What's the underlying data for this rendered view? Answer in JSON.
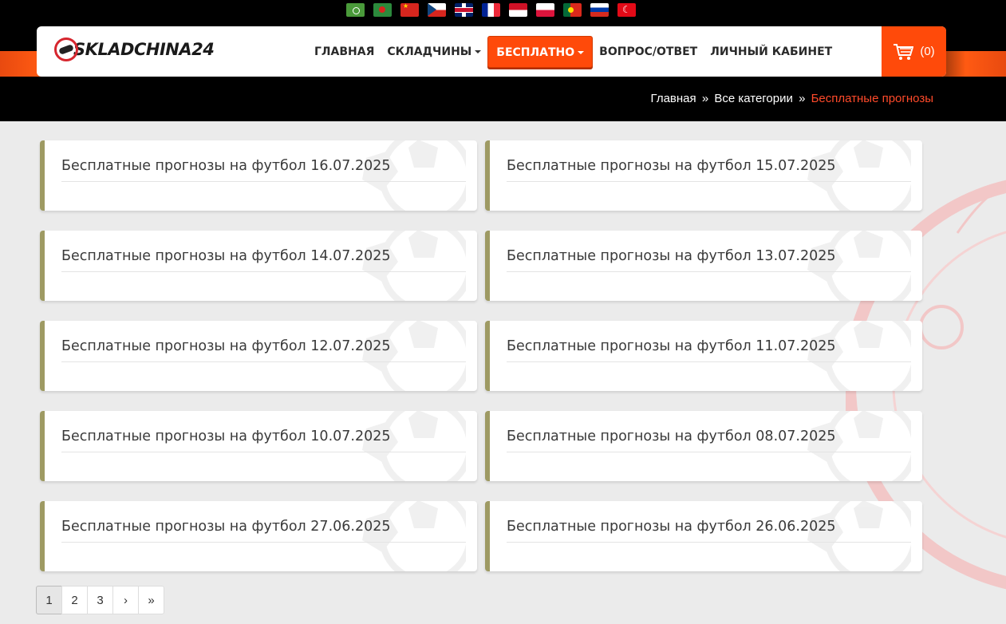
{
  "languages": [
    {
      "code": "ar",
      "icon": "flag-arabic-icon"
    },
    {
      "code": "bn",
      "icon": "flag-bangladesh-icon"
    },
    {
      "code": "zh",
      "icon": "flag-china-icon"
    },
    {
      "code": "cs",
      "icon": "flag-czech-icon"
    },
    {
      "code": "en",
      "icon": "flag-uk-icon"
    },
    {
      "code": "fr",
      "icon": "flag-france-icon"
    },
    {
      "code": "id",
      "icon": "flag-indonesia-icon"
    },
    {
      "code": "pl",
      "icon": "flag-poland-icon"
    },
    {
      "code": "pt",
      "icon": "flag-portugal-icon"
    },
    {
      "code": "ru",
      "icon": "flag-russia-icon"
    },
    {
      "code": "tr",
      "icon": "flag-turkey-icon"
    }
  ],
  "brand": {
    "name": "SKLADCHINA24",
    "accent": "#ff4a0a",
    "logo_red": "#d6262e"
  },
  "nav": {
    "home": "ГЛАВНАЯ",
    "skladchiny": "СКЛАДЧИНЫ",
    "free": "БЕСПЛАТНО",
    "faq": "ВОПРОС/ОТВЕТ",
    "account": "ЛИЧНЫЙ КАБИНЕТ"
  },
  "cart": {
    "count": "(0)",
    "icon": "cart-icon"
  },
  "breadcrumb": {
    "home": "Главная",
    "sep": "»",
    "categories": "Все категории",
    "current": "Бесплатные прогнозы"
  },
  "cards": [
    "Бесплатные прогнозы на футбол 16.07.2025",
    "Бесплатные прогнозы на футбол 15.07.2025",
    "Бесплатные прогнозы на футбол 14.07.2025",
    "Бесплатные прогнозы на футбол 13.07.2025",
    "Бесплатные прогнозы на футбол 12.07.2025",
    "Бесплатные прогнозы на футбол 11.07.2025",
    "Бесплатные прогнозы на футбол 10.07.2025",
    "Бесплатные прогнозы на футбол 08.07.2025",
    "Бесплатные прогнозы на футбол 27.06.2025",
    "Бесплатные прогнозы на футбол 26.06.2025"
  ],
  "pagination": {
    "pages": [
      "1",
      "2",
      "3"
    ],
    "next": "›",
    "last": "»",
    "active": "1"
  }
}
